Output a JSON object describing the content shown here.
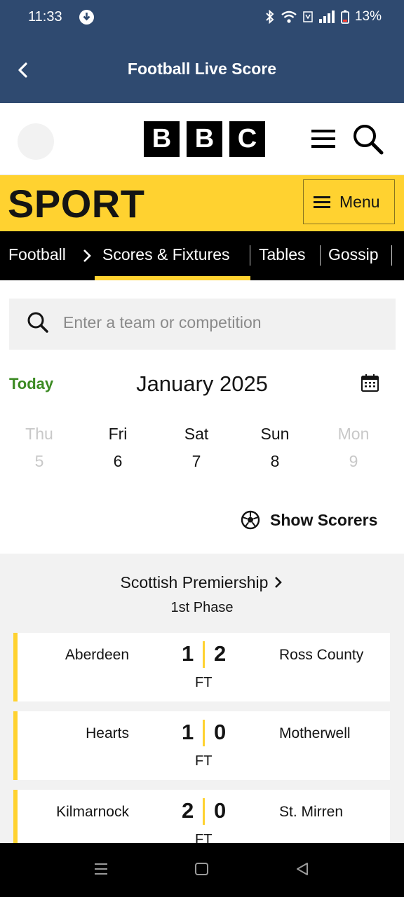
{
  "status_bar": {
    "time": "11:33",
    "battery": "13%"
  },
  "app_bar": {
    "title": "Football Live Score"
  },
  "bbc": {
    "letters": [
      "B",
      "B",
      "C"
    ]
  },
  "sport_bar": {
    "title": "SPORT",
    "menu_label": "Menu"
  },
  "nav": {
    "items": [
      "Football",
      "Scores & Fixtures",
      "Tables",
      "Gossip"
    ],
    "active": "Scores & Fixtures"
  },
  "search": {
    "placeholder": "Enter a team or competition"
  },
  "date": {
    "today_label": "Today",
    "month": "January 2025"
  },
  "days": [
    {
      "name": "Thu",
      "num": "5",
      "faded": true
    },
    {
      "name": "Fri",
      "num": "6",
      "faded": false
    },
    {
      "name": "Sat",
      "num": "7",
      "faded": false
    },
    {
      "name": "Sun",
      "num": "8",
      "faded": false
    },
    {
      "name": "Mon",
      "num": "9",
      "faded": true
    }
  ],
  "show_scorers": "Show Scorers",
  "competition": {
    "title": "Scottish Premiership",
    "subtitle": "1st Phase"
  },
  "matches": [
    {
      "home": "Aberdeen",
      "home_score": "1",
      "away_score": "2",
      "away": "Ross County",
      "status": "FT"
    },
    {
      "home": "Hearts",
      "home_score": "1",
      "away_score": "0",
      "away": "Motherwell",
      "status": "FT"
    },
    {
      "home": "Kilmarnock",
      "home_score": "2",
      "away_score": "0",
      "away": "St. Mirren",
      "status": "FT"
    }
  ],
  "colors": {
    "header_blue": "#2f4a70",
    "sport_yellow": "#ffd230",
    "today_green": "#3b8a22"
  }
}
